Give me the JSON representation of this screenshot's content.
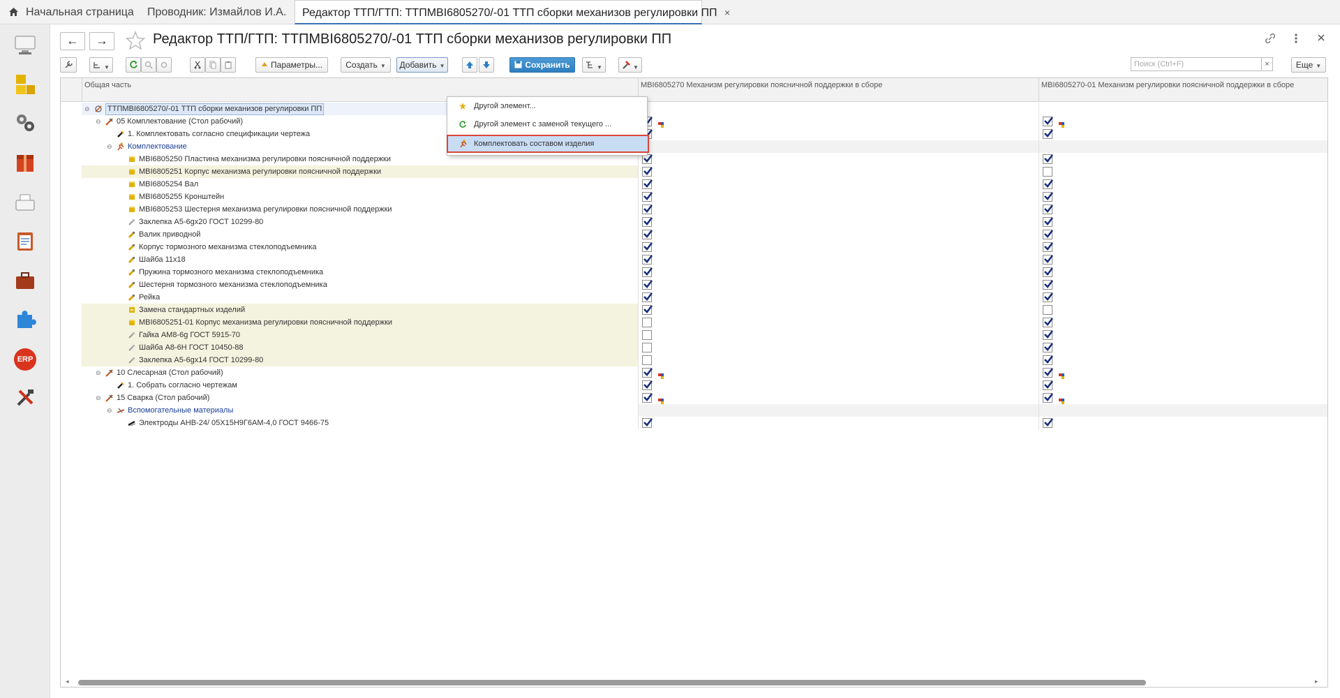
{
  "tabs": [
    {
      "label": "Начальная страница"
    },
    {
      "label": "Проводник: Измайлов И.А.",
      "close": "×"
    },
    {
      "label": "Редактор ТТП/ГТП: ТТПМВI6805270/-01 ТТП сборки механизов регулировки ПП",
      "close": "×"
    }
  ],
  "form": {
    "title": "Редактор ТТП/ГТП: ТТПМВI6805270/-01 ТТП сборки механизов регулировки ПП",
    "back": "←",
    "forward": "→"
  },
  "toolbar": {
    "params": "Параметры...",
    "create": "Создать",
    "add": "Добавить",
    "save": "Сохранить",
    "search_placeholder": "Поиск (Ctrl+F)",
    "search_clear": "×",
    "more": "Еще"
  },
  "grid": {
    "headers": [
      "Общая часть",
      "МВI6805270 Механизм регулировки поясничной поддержки в сборе",
      "МВI6805270-01 Механизм регулировки поясничной поддержки в сборе"
    ],
    "rows": [
      {
        "label": "ТТПМВI6805270/-01 ТТП сборки механизов регулировки ПП",
        "c1": null,
        "c2": null
      },
      {
        "label": "05 Комплектование (Стол рабочий)",
        "c1": true,
        "c2": true
      },
      {
        "label": "1. Комплектовать согласно спецификации чертежа",
        "c1": true,
        "c2": true
      },
      {
        "label": "Комплектование",
        "c1": null,
        "c2": null
      },
      {
        "label": "МВI6805250 Пластина механизма регулировки поясничной поддержки",
        "c1": true,
        "c2": true
      },
      {
        "label": "МВI6805251 Корпус механизма регулировки поясничной поддержки",
        "c1": true,
        "c2": false
      },
      {
        "label": "МВI6805254 Вал",
        "c1": true,
        "c2": true
      },
      {
        "label": "МВI6805255 Кронштейн",
        "c1": true,
        "c2": true
      },
      {
        "label": "МВI6805253 Шестерня механизма регулировки поясничной поддержки",
        "c1": true,
        "c2": true
      },
      {
        "label": "Заклепка А5-6gх20  ГОСТ 10299-80",
        "c1": true,
        "c2": true
      },
      {
        "label": "Валик приводной",
        "c1": true,
        "c2": true
      },
      {
        "label": "Корпус тормозного механизма стеклоподъемника",
        "c1": true,
        "c2": true
      },
      {
        "label": "Шайба 11х18",
        "c1": true,
        "c2": true
      },
      {
        "label": "Пружина тормозного механизма стеклоподъемника",
        "c1": true,
        "c2": true
      },
      {
        "label": "Шестерня тормозного механизма стеклоподъемника",
        "c1": true,
        "c2": true
      },
      {
        "label": "Рейка",
        "c1": true,
        "c2": true
      },
      {
        "label": "Замена стандартных изделий",
        "c1": true,
        "c2": false
      },
      {
        "label": "МВI6805251-01 Корпус механизма регулировки поясничной поддержки",
        "c1": false,
        "c2": true
      },
      {
        "label": "Гайка АМ8-6g  ГОСТ 5915-70",
        "c1": false,
        "c2": true
      },
      {
        "label": "Шайба А8-6Н  ГОСТ 10450-88",
        "c1": false,
        "c2": true
      },
      {
        "label": "Заклепка А5-6gх14  ГОСТ 10299-80",
        "c1": false,
        "c2": true
      },
      {
        "label": "10 Слесарная (Стол рабочий)",
        "c1": true,
        "c2": true
      },
      {
        "label": "1. Собрать согласно чертежам",
        "c1": true,
        "c2": true
      },
      {
        "label": "15 Сварка (Стол рабочий)",
        "c1": true,
        "c2": true
      },
      {
        "label": "Вспомогательные материалы",
        "c1": null,
        "c2": null
      },
      {
        "label": "Электроды АНВ-24/ 05Х15Н9Г6АМ-4,0 ГОСТ 9466-75",
        "c1": true,
        "c2": true
      }
    ]
  },
  "add_menu": {
    "items": [
      {
        "label": "Другой элемент..."
      },
      {
        "label": "Другой элемент с заменой текущего ..."
      },
      {
        "label": "Комплектовать составом изделия"
      }
    ]
  },
  "sidebar": {
    "items": [
      "desktop-icon",
      "yellow-blocks-icon",
      "gears-icon",
      "red-box-icon",
      "cash-register-icon",
      "clipboard-icon",
      "briefcase-icon",
      "puzzle-icon",
      "erp-icon",
      "tools-icon"
    ],
    "erp_label": "ERP"
  },
  "colors": {
    "accent": "#3b6fb6",
    "save": "#2f7fc1",
    "highlight_row": "#f4f3df",
    "menu_outline": "#d9463a"
  }
}
